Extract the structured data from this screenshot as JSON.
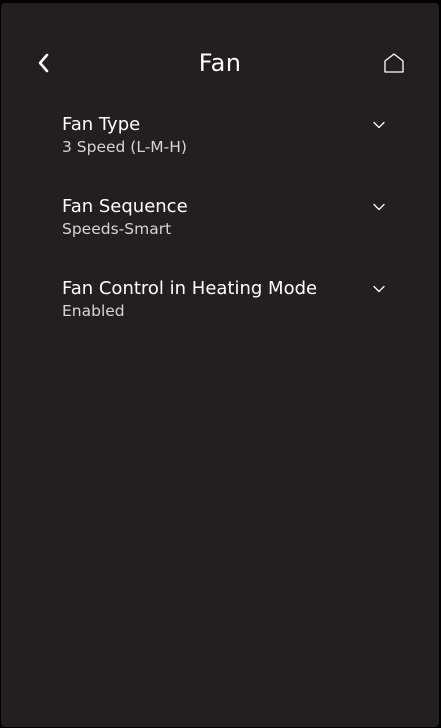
{
  "header": {
    "title": "Fan",
    "back_icon": "chevron-left-icon",
    "home_icon": "home-icon"
  },
  "settings": [
    {
      "label": "Fan Type",
      "value": "3 Speed (L-M-H)",
      "icon": "chevron-down-icon"
    },
    {
      "label": "Fan Sequence",
      "value": "Speeds-Smart",
      "icon": "chevron-down-icon"
    },
    {
      "label": "Fan Control in Heating Mode",
      "value": "Enabled",
      "icon": "chevron-down-icon"
    }
  ],
  "colors": {
    "background": "#231f20",
    "text_primary": "#ffffff",
    "text_secondary": "#d6d4d4"
  }
}
